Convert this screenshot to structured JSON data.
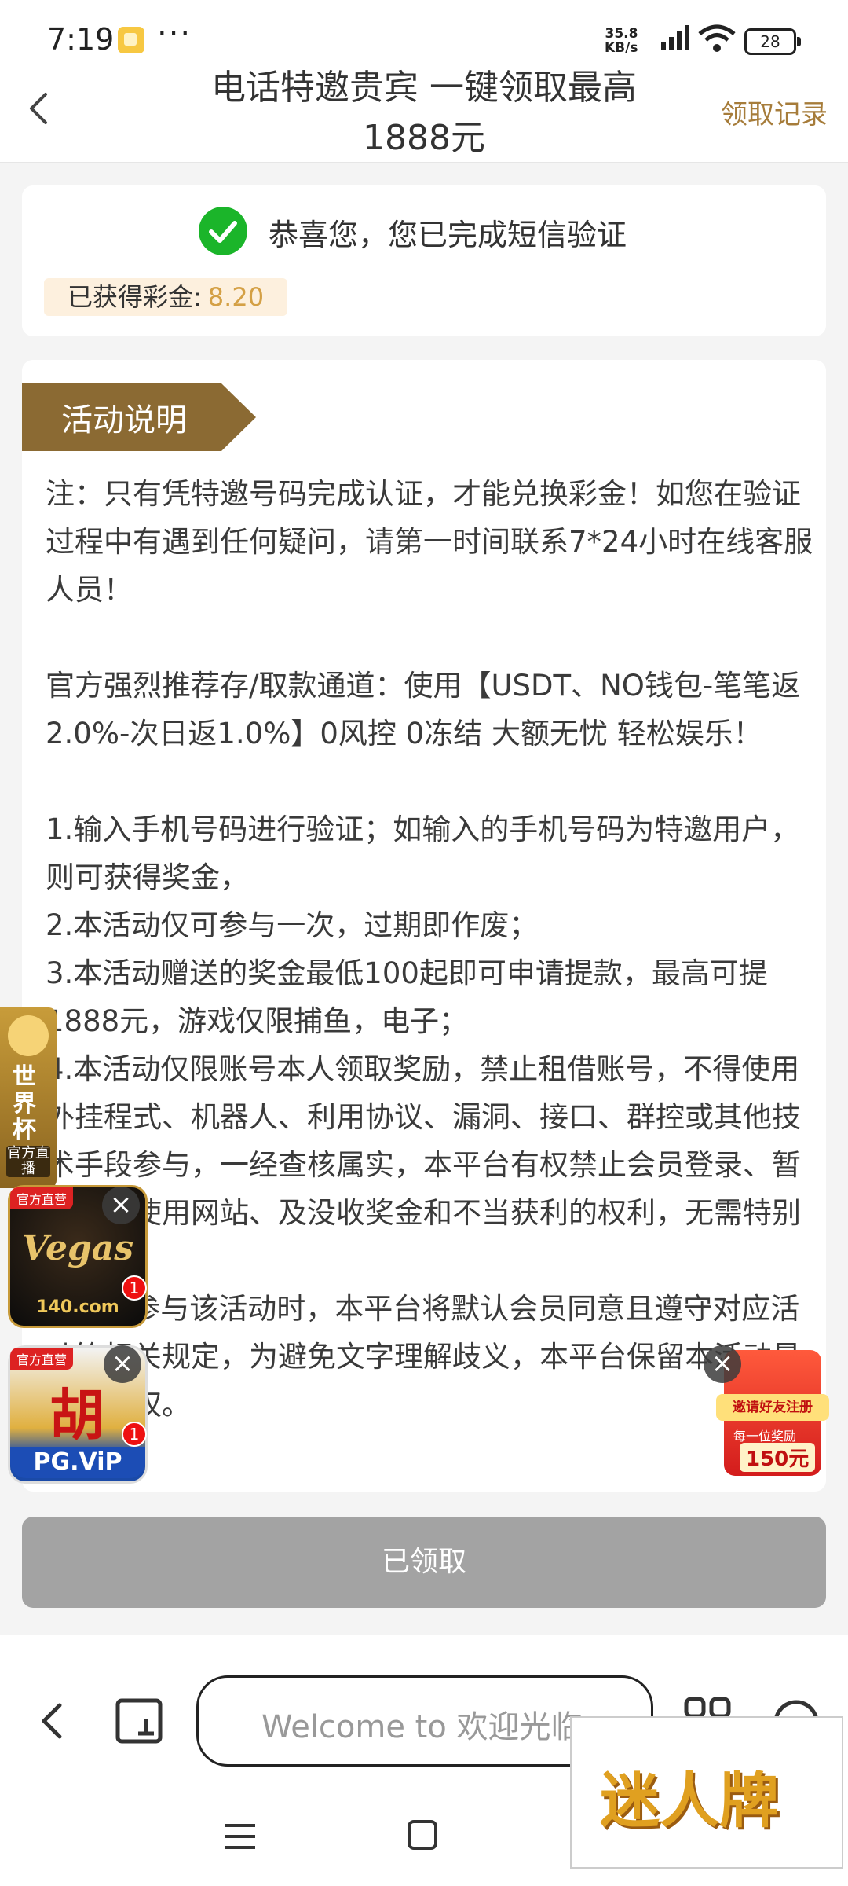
{
  "status_bar": {
    "time": "7:19",
    "more": "···",
    "net_speed": "35.8",
    "net_unit": "KB/s",
    "battery": "28"
  },
  "header": {
    "title_line1": "电话特邀贵宾 一键领取最高",
    "title_line2": "1888元",
    "records_link": "领取记录"
  },
  "success_card": {
    "message": "恭喜您，您已完成短信验证",
    "bonus_label": "已获得彩金:",
    "bonus_value": "8.20"
  },
  "activity": {
    "section_title": "活动说明",
    "note": "注：只有凭特邀号码完成认证，才能兑换彩金！如您在验证过程中有遇到任何疑问，请第一时间联系7*24小时在线客服人员！",
    "channel": "官方强烈推荐存/取款通道：使用【USDT、NO钱包-笔笔返2.0%-次日返1.0%】0风控 0冻结 大额无忧 轻松娱乐！",
    "rules": [
      "1.输入手机号码进行验证；如输入的手机号码为特邀用户，则可获得奖金，",
      "2.本活动仅可参与一次，过期即作废；",
      "3.本活动赠送的奖金最低100起即可申请提款，最高可提1888元，游戏仅限捕鱼，电子；",
      "4.本活动仅限账号本人领取奖励，禁止租借账号，不得使用外挂程式、机器人、利用协议、漏洞、接口、群控或其他技术手段参与，一经查核属实，本平台有权禁止会员登录、暂停会员使用网站、及没收奖金和不当获利的权利，无需特别通知；",
      "5.会员参与该活动时，本平台将默认会员同意且遵守对应活动等相关规定，为避免文字理解歧义，本平台保留本活动最终解释权。"
    ]
  },
  "ads": {
    "worldcup_text": "世界杯",
    "worldcup_live": "官方直播",
    "vegas_tag": "官方直营",
    "vegas_brand": "Vegas",
    "vegas_domain": "140.com",
    "pg_tag": "官方直营",
    "pg_char": "胡",
    "pg_label": "PG.ViP",
    "badge_count": "1",
    "invite_banner": "邀请好友注册",
    "invite_sub": "每一位奖励",
    "invite_amount": "150元"
  },
  "claimed_button": "已领取",
  "browser": {
    "url_text": "Welcome to 欢迎光临"
  },
  "watermark": "迷人牌",
  "colors": {
    "accent_gold": "#a67c3a",
    "bonus_value": "#d4a045",
    "success_green": "#1bb52a",
    "section_tag": "#8b6a33",
    "button_disabled": "#a3a3a3"
  }
}
